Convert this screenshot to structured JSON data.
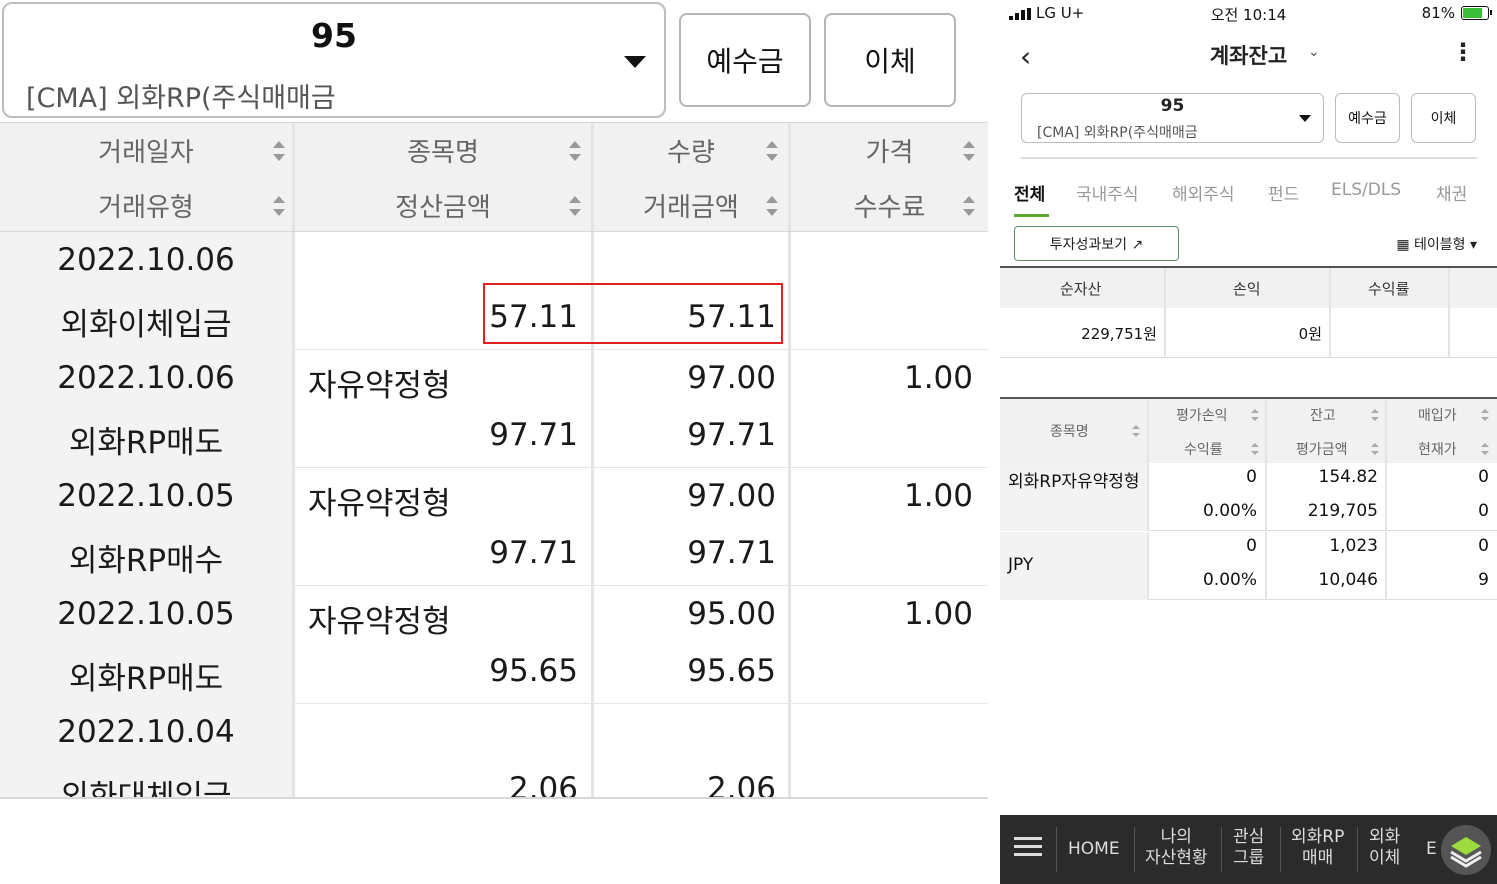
{
  "left": {
    "account_number": "95",
    "account_name": "[CMA] 외화RP(주식매매금",
    "deposit_button": "예수금",
    "transfer_button": "이체",
    "headers": {
      "row1": [
        "거래일자",
        "종목명",
        "수량",
        "가격"
      ],
      "row2": [
        "거래유형",
        "정산금액",
        "거래금액",
        "수수료"
      ]
    },
    "rows": [
      {
        "date": "2022.10.06",
        "type": "외화이체입금",
        "name": "",
        "settle": "57.11",
        "qty": "",
        "amount": "57.11",
        "price": "",
        "fee": ""
      },
      {
        "date": "2022.10.06",
        "type": "외화RP매도",
        "name": "자유약정형",
        "settle": "97.71",
        "qty": "97.00",
        "amount": "97.71",
        "price": "1.00",
        "fee": ""
      },
      {
        "date": "2022.10.05",
        "type": "외화RP매수",
        "name": "자유약정형",
        "settle": "97.71",
        "qty": "97.00",
        "amount": "97.71",
        "price": "1.00",
        "fee": ""
      },
      {
        "date": "2022.10.05",
        "type": "외화RP매도",
        "name": "자유약정형",
        "settle": "95.65",
        "qty": "95.00",
        "amount": "95.65",
        "price": "1.00",
        "fee": ""
      },
      {
        "date": "2022.10.04",
        "type": "외화대체입금",
        "name": "",
        "settle": "2.06",
        "qty": "",
        "amount": "2.06",
        "price": "",
        "fee": ""
      }
    ],
    "highlight_color": "#e02020"
  },
  "right": {
    "status": {
      "carrier": "LG U+",
      "time": "오전 10:14",
      "battery": "81%"
    },
    "nav": {
      "back": "‹",
      "title": "계좌잔고",
      "title_chevron": "⌄",
      "more": "⋮"
    },
    "account_number": "95",
    "account_name": "[CMA] 외화RP(주식매매금",
    "deposit_button": "예수금",
    "transfer_button": "이체",
    "tabs": [
      "전체",
      "국내주식",
      "해외주식",
      "펀드",
      "ELS/DLS",
      "채권"
    ],
    "perf_button": "투자성과보기 ↗",
    "view_toggle": "▦ 테이블형  ▾",
    "summary": {
      "headers": [
        "순자산",
        "손익",
        "수익률"
      ],
      "values": [
        "229,751원",
        "0원",
        ""
      ]
    },
    "detail": {
      "headers": {
        "name": "종목명",
        "row1": [
          "평가손익",
          "잔고",
          "매입가"
        ],
        "row2": [
          "수익률",
          "평가금액",
          "현재가"
        ]
      },
      "rows": [
        {
          "name": "외화RP자유약정형",
          "pnl": "0",
          "rate": "0.00%",
          "balance": "154.82",
          "eval": "219,705",
          "buy": "0",
          "cur": "0"
        },
        {
          "name": "JPY",
          "pnl": "0",
          "rate": "0.00%",
          "balance": "1,023",
          "eval": "10,046",
          "buy": "0",
          "cur": "9"
        }
      ]
    },
    "bottom": {
      "items": [
        "HOME",
        "나의\n자산현황",
        "관심\n그룹",
        "외화RP\n매매",
        "외화\n이체",
        "E"
      ]
    },
    "accent_color": "#5aa832"
  }
}
